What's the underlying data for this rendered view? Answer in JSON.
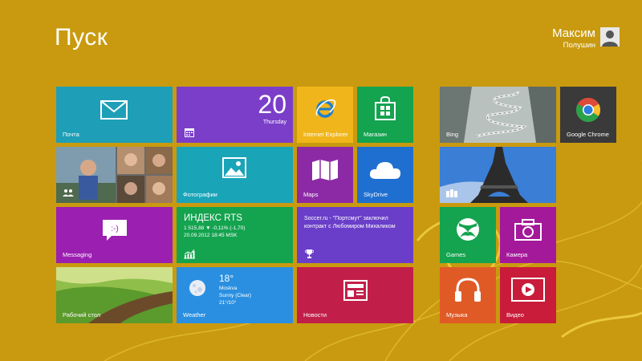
{
  "header": {
    "title": "Пуск",
    "user_name": "Максим",
    "user_surname": "Полушин"
  },
  "tiles": {
    "mail": {
      "label": "Почта"
    },
    "calendar": {
      "day_number": "20",
      "weekday": "Thursday"
    },
    "ie": {
      "label": "Internet Explorer"
    },
    "store": {
      "label": "Магазин"
    },
    "bing": {
      "label": "Bing"
    },
    "chrome": {
      "label": "Google Chrome"
    },
    "photos": {
      "label": "Фотографии"
    },
    "maps": {
      "label": "Maps"
    },
    "skydrive": {
      "label": "SkyDrive"
    },
    "messaging": {
      "label": "Messaging"
    },
    "finance": {
      "title": "ИНДЕКС RTS",
      "line1": "1 515,88  ▼ -0,11% (-1,70)",
      "line2": "20.09.2012 18:45 MSK"
    },
    "sports": {
      "headline": "Soccer.ru - \"Портсмут\" заключил контракт с Любомиром Михаликом"
    },
    "games": {
      "label": "Games"
    },
    "camera": {
      "label": "Камера"
    },
    "desktop": {
      "label": "Рабочий стол"
    },
    "weather": {
      "label": "Weather",
      "temp": "18°",
      "city": "Moskva",
      "condition": "Sunny (Clear)",
      "range": "21°/10°"
    },
    "news": {
      "label": "Новости"
    },
    "music": {
      "label": "Музыка"
    },
    "video": {
      "label": "Видео"
    }
  },
  "colors": {
    "background": "#c99a0f",
    "mail": "#1e9fb7",
    "calendar": "#7a3ec9",
    "ie": "#f0b51a",
    "store": "#14a34f",
    "chrome": "#3a3a3a",
    "photos": "#1aa4b8",
    "maps": "#8c2aa6",
    "skydrive": "#1f6fd0",
    "messaging": "#9b1fb0",
    "finance": "#14a34f",
    "sports": "#6a3ec9",
    "games": "#14a34f",
    "camera": "#a4199a",
    "weather": "#2a8fe0",
    "news": "#c11f4a",
    "music": "#e05a26",
    "video": "#c81c3a"
  }
}
